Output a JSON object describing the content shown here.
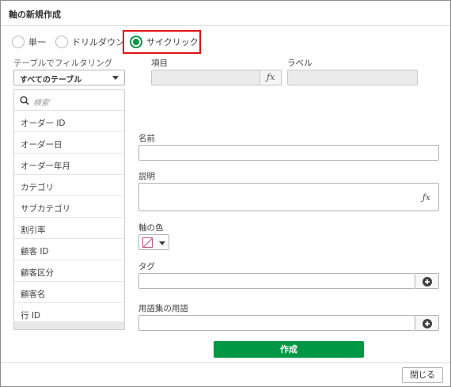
{
  "dialog": {
    "title": "軸の新規作成"
  },
  "dimension_type": {
    "options": [
      "単一",
      "ドリルダウン",
      "サイクリック"
    ],
    "selected": "サイクリック"
  },
  "filter": {
    "label": "テーブルでフィルタリング",
    "selected": "すべてのテーブル"
  },
  "field_list": {
    "search_placeholder": "検索",
    "items": [
      "オーダー ID",
      "オーダー日",
      "オーダー年月",
      "カテゴリ",
      "サブカテゴリ",
      "割引率",
      "顧客 ID",
      "顧客区分",
      "顧客名",
      "行 ID"
    ]
  },
  "columns": {
    "item": "項目",
    "label": "ラベル"
  },
  "form": {
    "name_label": "名前",
    "description_label": "説明",
    "color_label": "軸の色",
    "tags_label": "タグ",
    "glossary_label": "用語集の用語",
    "fx_symbol": "ƒx"
  },
  "buttons": {
    "create": "作成",
    "close": "閉じる"
  },
  "colors": {
    "accent": "#009845",
    "highlight": "#e21414"
  }
}
